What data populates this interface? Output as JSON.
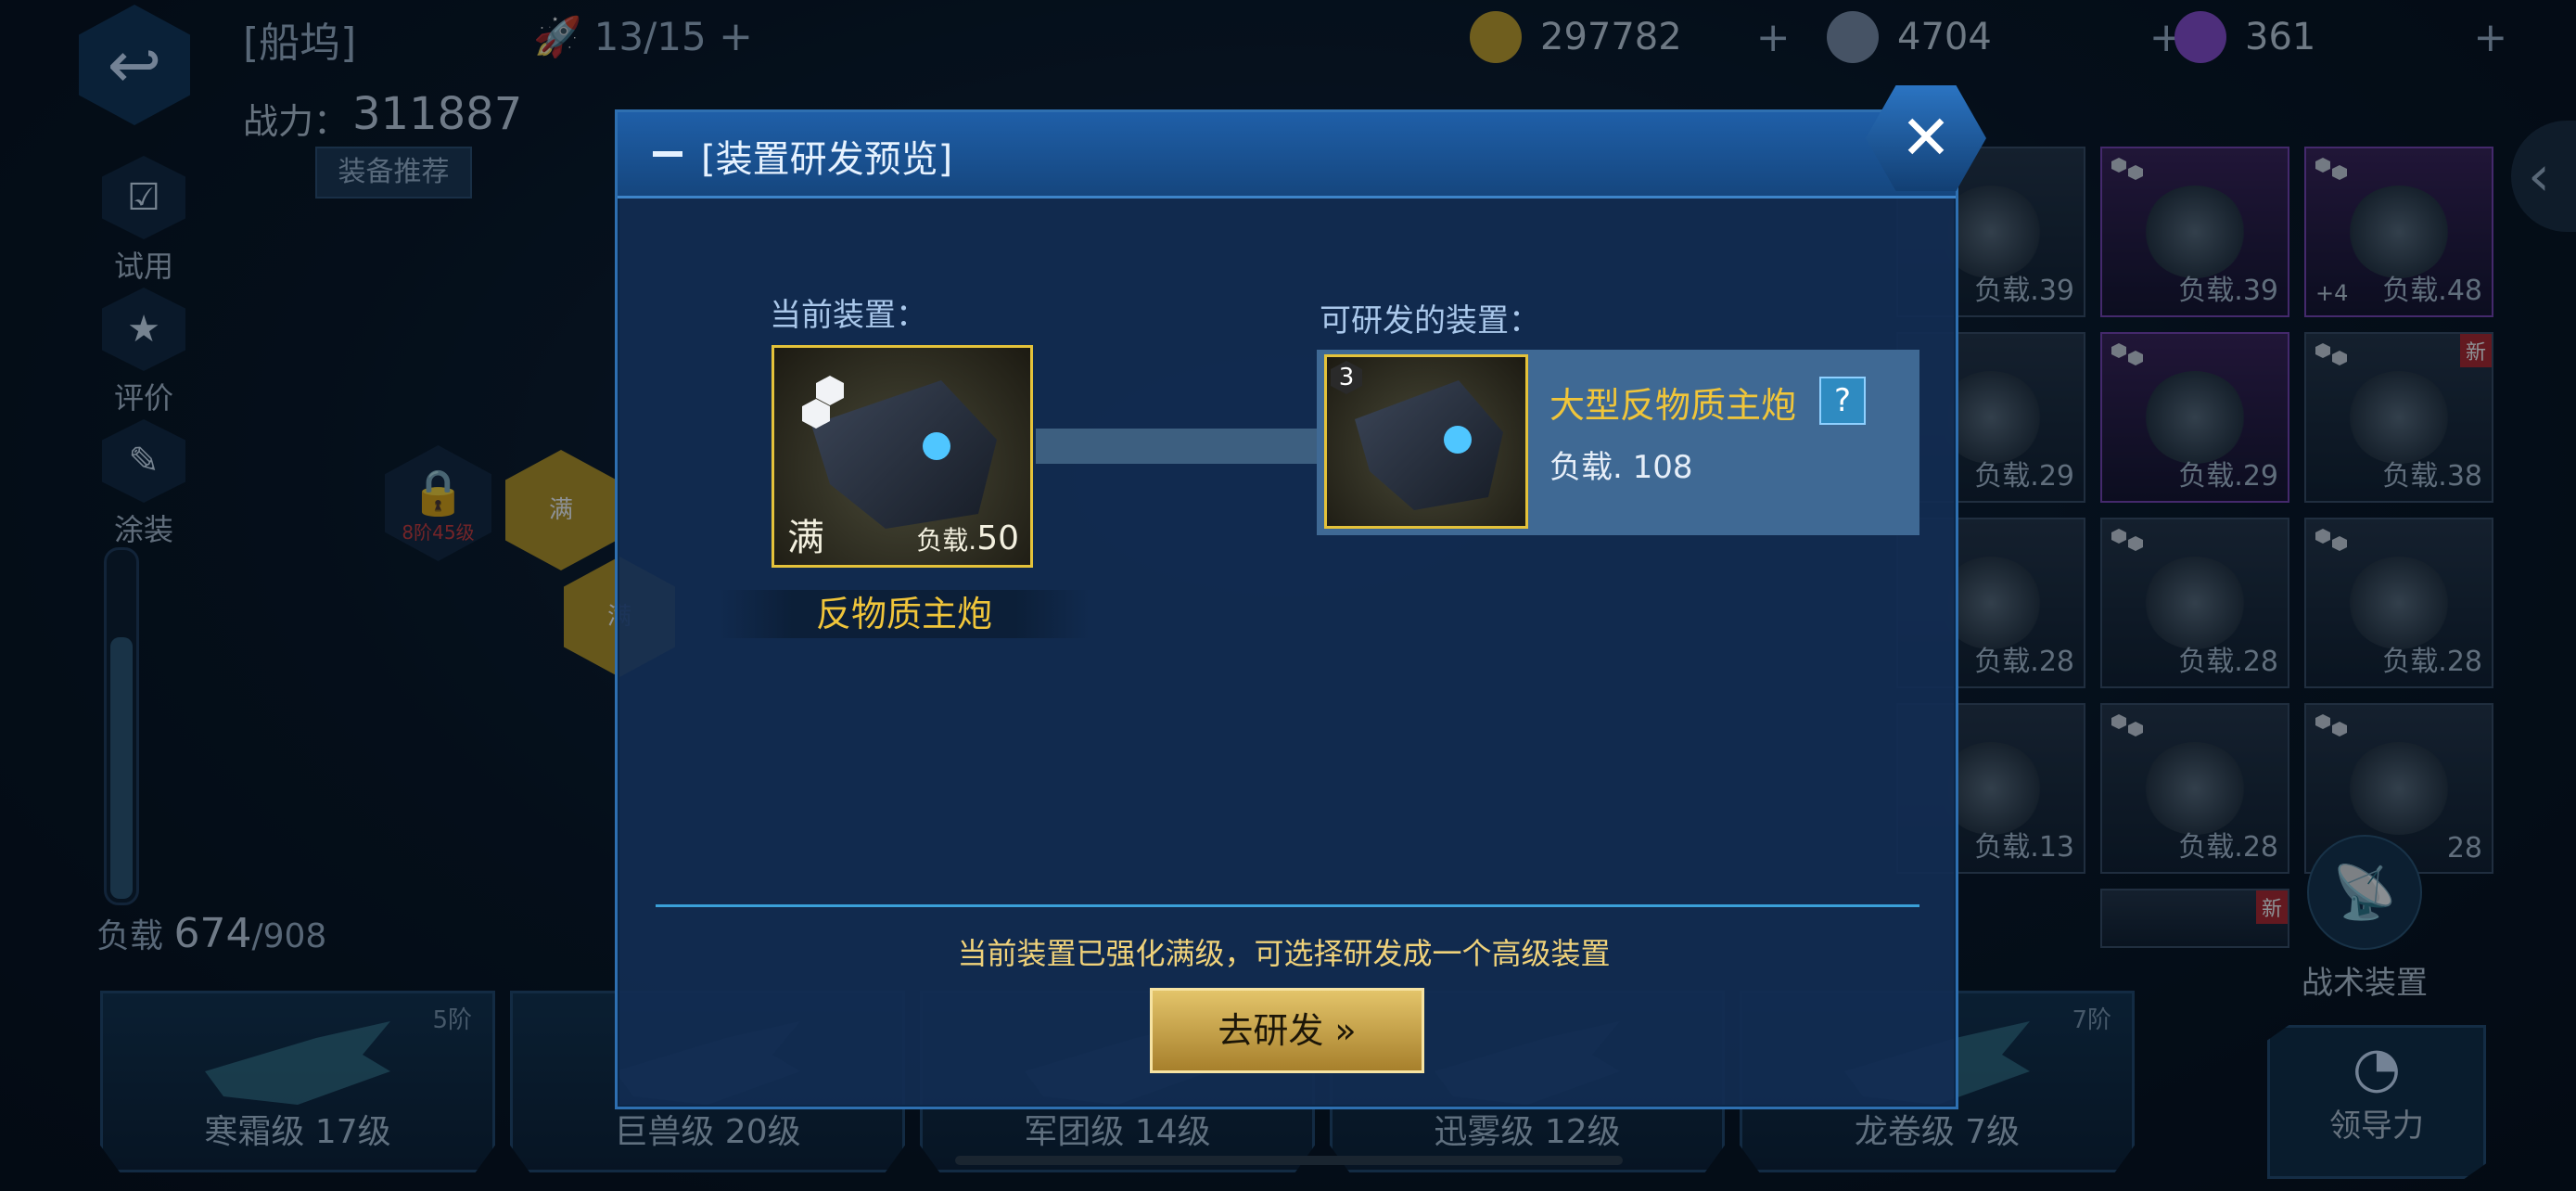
{
  "topbar": {
    "back_icon": "back-arrow-icon",
    "title": "[船坞]",
    "ship_count": "13/15",
    "plus": "+",
    "currencies": [
      {
        "name": "gold",
        "value": "297782",
        "icon": "gold-coin-icon",
        "color": "#c9a227"
      },
      {
        "name": "ore",
        "value": "4704",
        "icon": "ore-icon",
        "color": "#7f8fa8"
      },
      {
        "name": "crystal",
        "value": "361",
        "icon": "crystal-icon",
        "color": "#8a4bd0"
      }
    ]
  },
  "power": {
    "label": "战力：",
    "value": "311887"
  },
  "recommend": "装备推荐",
  "sidebar": {
    "items": [
      {
        "label": "试用",
        "icon": "checklist-icon"
      },
      {
        "label": "评价",
        "icon": "rating-icon"
      },
      {
        "label": "涂装",
        "icon": "spray-icon"
      }
    ]
  },
  "load": {
    "label": "负载",
    "current": "674",
    "max": "/908",
    "fraction": 0.742
  },
  "hexes": {
    "locked_text": "8阶45级",
    "full_text": "满"
  },
  "grid": {
    "cells": [
      {
        "lv": "负载.39",
        "purple": false
      },
      {
        "lv": "负载.39",
        "purple": true
      },
      {
        "lv": "负载.48",
        "purple": true,
        "plus": "+4"
      },
      {
        "lv": "负载.29",
        "purple": false
      },
      {
        "lv": "负载.29",
        "purple": true
      },
      {
        "lv": "负载.38",
        "purple": false,
        "new": "新"
      },
      {
        "lv": "负载.28",
        "purple": false
      },
      {
        "lv": "负载.28",
        "purple": false
      },
      {
        "lv": "负载.28",
        "purple": false
      },
      {
        "lv": "负载.13",
        "purple": false
      },
      {
        "lv": "负载.28",
        "purple": false
      },
      {
        "lv": "28",
        "purple": false
      }
    ],
    "new_badge": "新"
  },
  "tactic": {
    "label": "战术装置",
    "icon": "radar-icon"
  },
  "ships": [
    {
      "name": "寒霜级 17级",
      "tier": "5阶"
    },
    {
      "name": "巨兽级 20级",
      "tier": ""
    },
    {
      "name": "军团级 14级",
      "tier": ""
    },
    {
      "name": "迅雾级 12级",
      "tier": ""
    },
    {
      "name": "龙卷级 7级",
      "tier": "7阶"
    }
  ],
  "leader": {
    "label": "领导力",
    "icon": "gauge-icon"
  },
  "modal": {
    "title": "[装置研发预览]",
    "close_icon": "close-icon",
    "current_label": "当前装置：",
    "current_full": "满",
    "current_load_label": "负载.",
    "current_load_value": "50",
    "current_name": "反物质主炮",
    "research_label": "可研发的装置：",
    "research_grade": "3",
    "research_name": "大型反物质主炮",
    "help": "?",
    "research_load": "负载. 108",
    "tip": "当前装置已强化满级，可选择研发成一个高级装置",
    "button": "去研发 »"
  }
}
